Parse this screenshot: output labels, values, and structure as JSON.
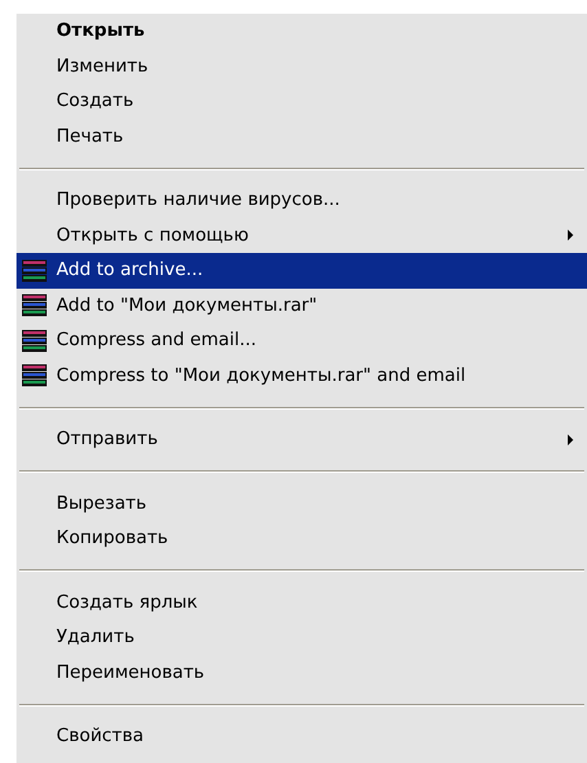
{
  "context_menu": {
    "groups": [
      {
        "items": [
          {
            "label": "Открыть",
            "kind": "command",
            "default": true,
            "selected": false
          },
          {
            "label": "Изменить",
            "kind": "command",
            "default": false,
            "selected": false
          },
          {
            "label": "Создать",
            "kind": "command",
            "default": false,
            "selected": false
          },
          {
            "label": "Печать",
            "kind": "command",
            "default": false,
            "selected": false
          }
        ]
      },
      {
        "items": [
          {
            "label": "Проверить наличие вирусов...",
            "kind": "command",
            "default": false,
            "selected": false
          },
          {
            "label": "Открыть с помощью",
            "kind": "submenu",
            "default": false,
            "selected": false
          },
          {
            "label": "Add to archive...",
            "kind": "archive",
            "default": false,
            "selected": true
          },
          {
            "label": "Add to \"Мои документы.rar\"",
            "kind": "archive",
            "default": false,
            "selected": false
          },
          {
            "label": "Compress and email...",
            "kind": "archive",
            "default": false,
            "selected": false
          },
          {
            "label": "Compress to \"Мои документы.rar\" and email",
            "kind": "archive",
            "default": false,
            "selected": false
          }
        ]
      },
      {
        "items": [
          {
            "label": "Отправить",
            "kind": "submenu",
            "default": false,
            "selected": false
          }
        ]
      },
      {
        "items": [
          {
            "label": "Вырезать",
            "kind": "command",
            "default": false,
            "selected": false
          },
          {
            "label": "Копировать",
            "kind": "command",
            "default": false,
            "selected": false
          }
        ]
      },
      {
        "items": [
          {
            "label": "Создать ярлык",
            "kind": "command",
            "default": false,
            "selected": false
          },
          {
            "label": "Удалить",
            "kind": "command",
            "default": false,
            "selected": false
          },
          {
            "label": "Переименовать",
            "kind": "command",
            "default": false,
            "selected": false
          }
        ]
      },
      {
        "items": [
          {
            "label": "Свойства",
            "kind": "command",
            "default": false,
            "selected": false
          }
        ]
      }
    ]
  }
}
